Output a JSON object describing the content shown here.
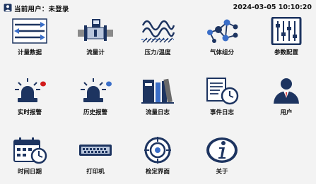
{
  "header": {
    "user_label": "当前用户：未登录",
    "datetime": "2024-03-05 10:10:20"
  },
  "tiles": [
    {
      "label": "计量数据",
      "icon": "metering-data-icon"
    },
    {
      "label": "流量计",
      "icon": "flowmeter-icon"
    },
    {
      "label": "压力/温度",
      "icon": "pressure-temperature-icon"
    },
    {
      "label": "气体组分",
      "icon": "gas-composition-icon"
    },
    {
      "label": "参数配置",
      "icon": "parameter-config-icon"
    },
    {
      "label": "实时报警",
      "icon": "realtime-alarm-icon"
    },
    {
      "label": "历史报警",
      "icon": "history-alarm-icon"
    },
    {
      "label": "流量日志",
      "icon": "flow-log-icon"
    },
    {
      "label": "事件日志",
      "icon": "event-log-icon"
    },
    {
      "label": "用户",
      "icon": "user-icon"
    },
    {
      "label": "时间日期",
      "icon": "calendar-clock-icon"
    },
    {
      "label": "打印机",
      "icon": "printer-icon"
    },
    {
      "label": "检定界面",
      "icon": "calibration-icon"
    },
    {
      "label": "关于",
      "icon": "info-icon"
    }
  ],
  "colors": {
    "navy": "#1d3460",
    "blue": "#3a6ec8",
    "red": "#d21b1b",
    "grey": "#6a6a6a",
    "background": "#f3f3f3"
  }
}
